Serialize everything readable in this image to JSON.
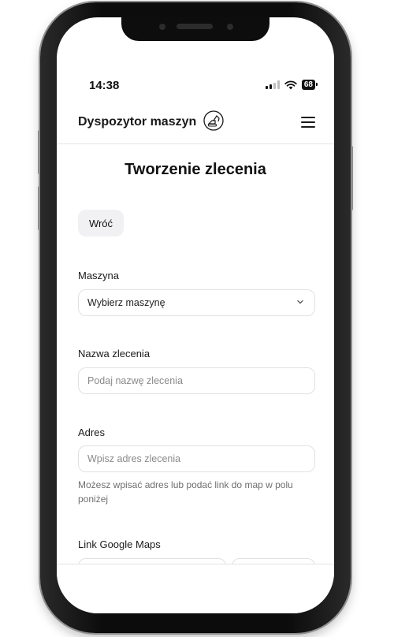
{
  "status_bar": {
    "time": "14:38",
    "battery": "68"
  },
  "header": {
    "app_title": "Dyspozytor maszyn",
    "logo_icon": "excavator-icon",
    "menu_icon": "hamburger-icon"
  },
  "page": {
    "title": "Tworzenie zlecenia",
    "back_label": "Wróć"
  },
  "form": {
    "machine": {
      "label": "Maszyna",
      "value": "Wybierz maszynę"
    },
    "order_name": {
      "label": "Nazwa zlecenia",
      "placeholder": "Podaj nazwę zlecenia"
    },
    "address": {
      "label": "Adres",
      "placeholder": "Wpisz adres zlecenia",
      "help": "Możesz wpisać adres lub podać link do map w polu poniżej"
    },
    "maps_link": {
      "label": "Link Google Maps"
    }
  }
}
